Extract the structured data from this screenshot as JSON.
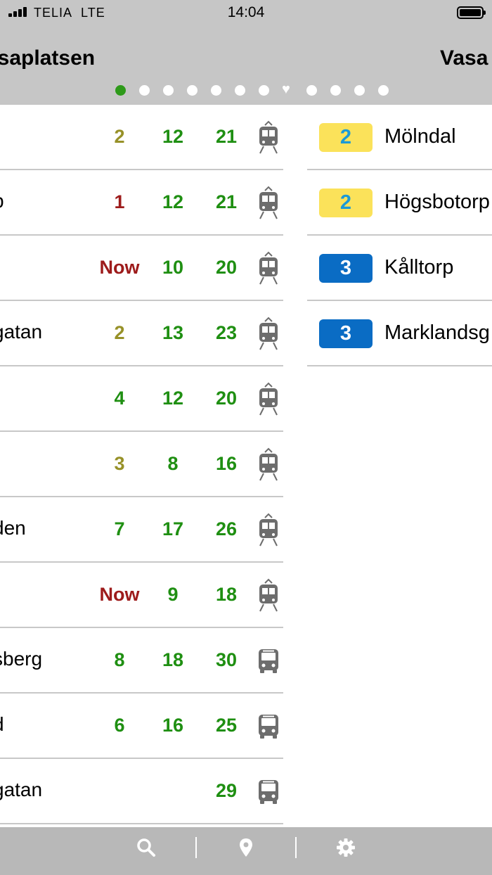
{
  "status_bar": {
    "carrier": "TELIA",
    "network": "LTE",
    "time": "14:04",
    "signal_bars": 4,
    "battery_level": 1.0
  },
  "header": {
    "left_title": "asaplatsen",
    "right_title": "Vasa",
    "page_dots": [
      {
        "type": "dot",
        "active": true
      },
      {
        "type": "dot",
        "active": false
      },
      {
        "type": "dot",
        "active": false
      },
      {
        "type": "dot",
        "active": false
      },
      {
        "type": "dot",
        "active": false
      },
      {
        "type": "dot",
        "active": false
      },
      {
        "type": "dot",
        "active": false
      },
      {
        "type": "heart",
        "active": false
      },
      {
        "type": "dot",
        "active": false
      },
      {
        "type": "dot",
        "active": false
      },
      {
        "type": "dot",
        "active": false
      },
      {
        "type": "dot",
        "active": false
      }
    ]
  },
  "colors": {
    "header_bg": "#c6c6c6",
    "green": "#1f8f12",
    "olive": "#979128",
    "red": "#9d1b1b",
    "badge_yellow": "#fbe25a",
    "badge_yellow_text": "#1b9ad7",
    "badge_blue": "#0a6cc4",
    "active_dot": "#2e9a1a"
  },
  "departures": [
    {
      "name": "",
      "times": [
        {
          "v": "2",
          "c": "olive"
        },
        {
          "v": "12",
          "c": "green"
        },
        {
          "v": "21",
          "c": "green"
        }
      ],
      "vehicle": "tram-icon"
    },
    {
      "name": "p",
      "times": [
        {
          "v": "1",
          "c": "red"
        },
        {
          "v": "12",
          "c": "green"
        },
        {
          "v": "21",
          "c": "green"
        }
      ],
      "vehicle": "tram-icon"
    },
    {
      "name": "",
      "times": [
        {
          "v": "Now",
          "c": "red"
        },
        {
          "v": "10",
          "c": "green"
        },
        {
          "v": "20",
          "c": "green"
        }
      ],
      "vehicle": "tram-icon"
    },
    {
      "name": "gatan",
      "times": [
        {
          "v": "2",
          "c": "olive"
        },
        {
          "v": "13",
          "c": "green"
        },
        {
          "v": "23",
          "c": "green"
        }
      ],
      "vehicle": "tram-icon"
    },
    {
      "name": "",
      "times": [
        {
          "v": "4",
          "c": "green"
        },
        {
          "v": "12",
          "c": "green"
        },
        {
          "v": "20",
          "c": "green"
        }
      ],
      "vehicle": "tram-icon"
    },
    {
      "name": "",
      "times": [
        {
          "v": "3",
          "c": "olive"
        },
        {
          "v": "8",
          "c": "green"
        },
        {
          "v": "16",
          "c": "green"
        }
      ],
      "vehicle": "tram-icon"
    },
    {
      "name": "den",
      "times": [
        {
          "v": "7",
          "c": "green"
        },
        {
          "v": "17",
          "c": "green"
        },
        {
          "v": "26",
          "c": "green"
        }
      ],
      "vehicle": "tram-icon"
    },
    {
      "name": "",
      "times": [
        {
          "v": "Now",
          "c": "red"
        },
        {
          "v": "9",
          "c": "green"
        },
        {
          "v": "18",
          "c": "green"
        }
      ],
      "vehicle": "tram-icon"
    },
    {
      "name": "sberg",
      "times": [
        {
          "v": "8",
          "c": "green"
        },
        {
          "v": "18",
          "c": "green"
        },
        {
          "v": "30",
          "c": "green"
        }
      ],
      "vehicle": "bus-icon"
    },
    {
      "name": "d",
      "times": [
        {
          "v": "6",
          "c": "green"
        },
        {
          "v": "16",
          "c": "green"
        },
        {
          "v": "25",
          "c": "green"
        }
      ],
      "vehicle": "bus-icon"
    },
    {
      "name": "gatan",
      "times": [
        {
          "v": "",
          "c": "green"
        },
        {
          "v": "",
          "c": "green"
        },
        {
          "v": "29",
          "c": "green"
        }
      ],
      "vehicle": "bus-icon"
    }
  ],
  "lines": [
    {
      "number": "2",
      "style": "yellow",
      "destination": "Mölndal"
    },
    {
      "number": "2",
      "style": "yellow",
      "destination": "Högsbotorp"
    },
    {
      "number": "3",
      "style": "blue",
      "destination": "Kålltorp"
    },
    {
      "number": "3",
      "style": "blue",
      "destination": "Marklandsg"
    }
  ],
  "bottom_bar": {
    "icons": [
      "search-icon",
      "location-pin-icon",
      "gear-icon"
    ]
  }
}
